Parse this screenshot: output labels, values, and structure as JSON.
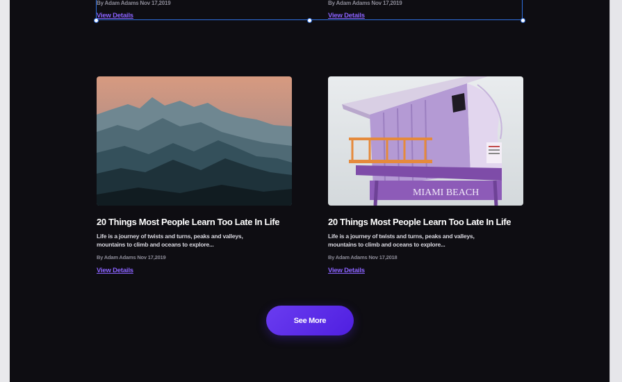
{
  "colors": {
    "canvas_bg": "#0e0d12",
    "accent": "#8b63ff",
    "button": "#5a2ae6",
    "selection": "#2f6fe0"
  },
  "top_cards": [
    {
      "meta": "By Adam Adams Nov 17,2019",
      "link": "View Details"
    },
    {
      "meta": "By Adam Adams Nov 17,2019",
      "link": "View Details"
    }
  ],
  "cards": [
    {
      "image": "mountains-image",
      "title": "20 Things Most People Learn Too Late In Life",
      "excerpt": "Life is a journey of twists and turns, peaks and valleys, mountains to climb and oceans to explore...",
      "meta": "By Adam Adams Nov 17,2019",
      "link": "View Details"
    },
    {
      "image": "lifeguard-tower-image",
      "image_text": "MIAMI BEACH",
      "title": "20 Things Most People Learn Too Late In Life",
      "excerpt": "Life is a journey of twists and turns, peaks and valleys, mountains to climb and oceans to explore...",
      "meta": "By Adam Adams Nov 17,2018",
      "link": "View Details"
    }
  ],
  "see_more_label": "See More"
}
